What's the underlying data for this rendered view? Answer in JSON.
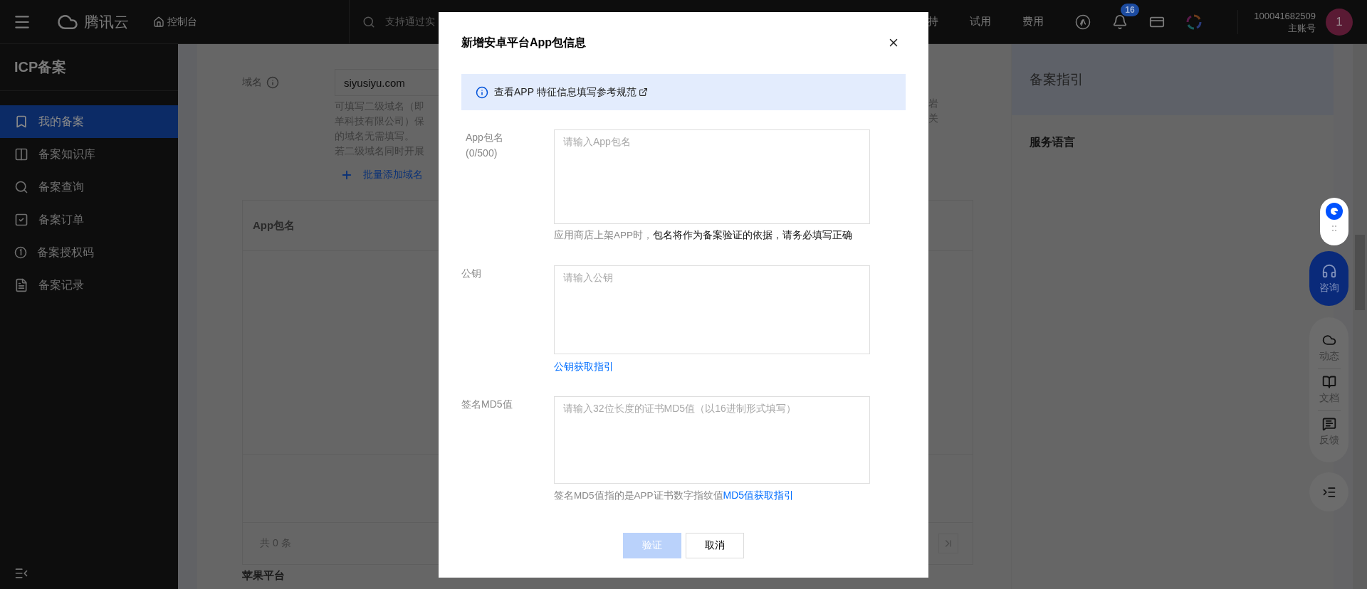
{
  "top_bar": {
    "brand": "腾讯云",
    "console": "控制台",
    "search": {
      "placeholder": "支持通过实"
    },
    "nav": [
      {
        "label": "持"
      },
      {
        "label": "试用"
      },
      {
        "label": "费用"
      }
    ],
    "notifications": {
      "badge": "16"
    },
    "account": {
      "id": "100041682509",
      "role": "主账号",
      "avatar": "1"
    }
  },
  "sidebar": {
    "title": "ICP备案",
    "items": [
      {
        "label": "我的备案",
        "selected": true
      },
      {
        "label": "备案知识库",
        "selected": false
      },
      {
        "label": "备案查询",
        "selected": false
      },
      {
        "label": "备案订单",
        "selected": false
      },
      {
        "label": "备案授权码",
        "selected": false
      },
      {
        "label": "备案记录",
        "selected": false
      }
    ]
  },
  "domain_form": {
    "label": "域名",
    "value": "siyusiyu.com",
    "hint_lines": [
      "可填写二级域名（即",
      "羊科技有限公司）保",
      "的域名无需填写。",
      "若二级域名同时开展"
    ],
    "hint_fragments": [
      "岩",
      "关"
    ],
    "add_link": "批量添加域名"
  },
  "app_table": {
    "columns": [
      "App包名"
    ],
    "footer": "共 0 条"
  },
  "next_section": "苹果平台",
  "guide_panel": {
    "title": "备案指引",
    "section": "服务语言"
  },
  "float_widgets": {
    "consult": "咨询",
    "tools": [
      "动态",
      "文档",
      "反馈"
    ]
  },
  "dialog": {
    "title": "新增安卓平台App包信息",
    "notice": "查看APP 特征信息填写参考规范",
    "fields": [
      {
        "label": "App包名",
        "counter": "(0/500)",
        "placeholder": "请输入App包名",
        "help": "应用商店上架APP时，**包名将作为备案验证的依据，请务必填写正确**"
      },
      {
        "label": "公钥",
        "placeholder": "请输入公钥",
        "link": "公钥获取指引"
      },
      {
        "label": "签名MD5值",
        "placeholder": "请输入32位长度的证书MD5值（以16进制形式填写）",
        "help": "签名MD5值指的是APP证书数字指纹值",
        "help_link": "MD5值获取指引"
      }
    ],
    "buttons": [
      {
        "label": "验证",
        "kind": "primary",
        "disabled": true
      },
      {
        "label": "取消",
        "kind": "default",
        "disabled": false
      }
    ]
  }
}
